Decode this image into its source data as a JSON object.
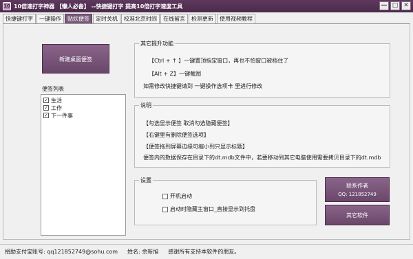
{
  "window": {
    "icon_text": "10",
    "title": "10倍速打字神器 【懒人必备】 --快捷键打字 提高10倍打字速度工具",
    "minimize": "—",
    "restore": "□",
    "close": "✕"
  },
  "tabs": [
    {
      "label": "快捷键打字"
    },
    {
      "label": "一键操作"
    },
    {
      "label": "贴炊便签"
    },
    {
      "label": "定时关机"
    },
    {
      "label": "校准北京时间"
    },
    {
      "label": "在线留言"
    },
    {
      "label": "检测更新"
    },
    {
      "label": "使用视频教程"
    }
  ],
  "active_tab_index": 2,
  "notes": {
    "new_button": "新建桌面便签",
    "list_label": "便签列表",
    "items": [
      {
        "label": "生活",
        "checked": true
      },
      {
        "label": "工作",
        "checked": true
      },
      {
        "label": "下一件事",
        "checked": true
      }
    ]
  },
  "other_features": {
    "title": "其它提升功能",
    "lines": [
      "【Ctrl + ↑ 】一键置顶指定窗口，再也不怕窗口被档住了",
      "【Alt + Z】一键截图",
      "如需修改快捷键请到  一键操作选项卡  里进行修改"
    ]
  },
  "help": {
    "title": "说明",
    "lines": [
      "【勾选显示便签       取消勾选隐藏便签】",
      "【右键里有删除便签选项】",
      "【便签拖到屏幕边缘可缩小到只显示标题】",
      "便签内的数据保存在目录下的dt.mdb文件中，若要移动到其它电脑使用需要拷贝目录下的dt.mdb"
    ]
  },
  "settings": {
    "title": "设置",
    "autostart": {
      "label": "开机启动",
      "checked": false
    },
    "hide_main": {
      "label": "启动时隐藏主窗口_直接显示到托盘",
      "checked": false
    }
  },
  "contact_button": {
    "line1": "联系作者",
    "line2": "QQ: 121852749"
  },
  "other_software_button": "其它软件",
  "status": {
    "alipay": "捐助支付宝账号: qq121852749@sohu.com",
    "name": "姓名: 余新旭",
    "thanks": "感谢所有支持本软件的朋友。"
  }
}
